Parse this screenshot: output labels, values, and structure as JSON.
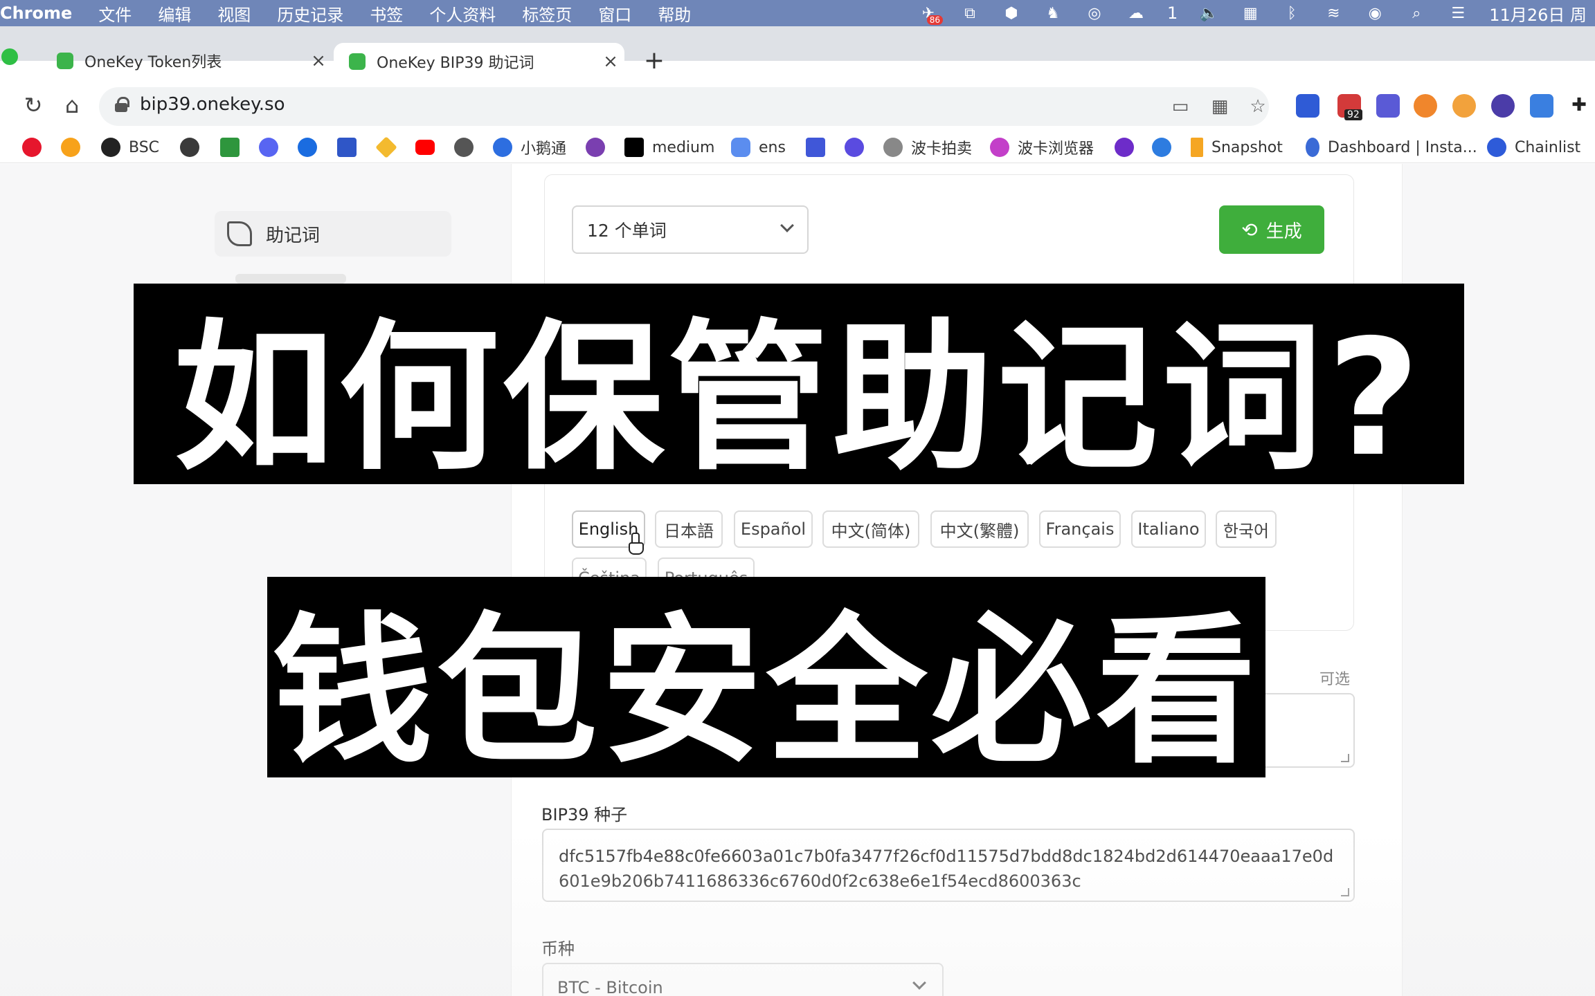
{
  "menubar": {
    "app": "Chrome",
    "items": [
      "文件",
      "编辑",
      "视图",
      "历史记录",
      "书签",
      "个人资料",
      "标签页",
      "窗口",
      "帮助"
    ],
    "notification_badge": "86",
    "wechat_count": "1",
    "date": "11月26日 周"
  },
  "tabs": [
    {
      "label": "OneKey Token列表"
    },
    {
      "label": "OneKey BIP39 助记词"
    }
  ],
  "toolbar": {
    "url": "bip39.onekey.so",
    "ext_badge": "92"
  },
  "bookmarks": [
    "BSC",
    "小鹅通",
    "medium",
    "ens",
    "波卡拍卖",
    "波卡浏览器",
    "Snapshot",
    "Dashboard | Insta...",
    "Chainlist"
  ],
  "sidebar": {
    "items": [
      {
        "label": "助记词"
      }
    ]
  },
  "generator": {
    "word_count": "12 个单词",
    "generate_label": "生成"
  },
  "languages": [
    "English",
    "日本語",
    "Español",
    "中文(简体)",
    "中文(繁體)",
    "Français",
    "Italiano",
    "한국어",
    "Čeština",
    "Português"
  ],
  "passphrase": {
    "optional_label": "可选"
  },
  "seed": {
    "label": "BIP39 种子",
    "value": "dfc5157fb4e88c0fe6603a01c7b0fa3477f26cf0d11575d7bdd8dc1824bd2d614470eaaa17e0d601e9b206b7411686336c6760d0f2c638e6e1f54ecd8600363c"
  },
  "coin": {
    "label": "币种",
    "selected": "BTC - Bitcoin"
  },
  "overlay": {
    "line1": "如何保管助记词?",
    "line2": "钱包安全必看"
  },
  "colors": {
    "menubar": "#6f86b8",
    "generate_button": "#3fae3c",
    "banner": "#000000"
  }
}
